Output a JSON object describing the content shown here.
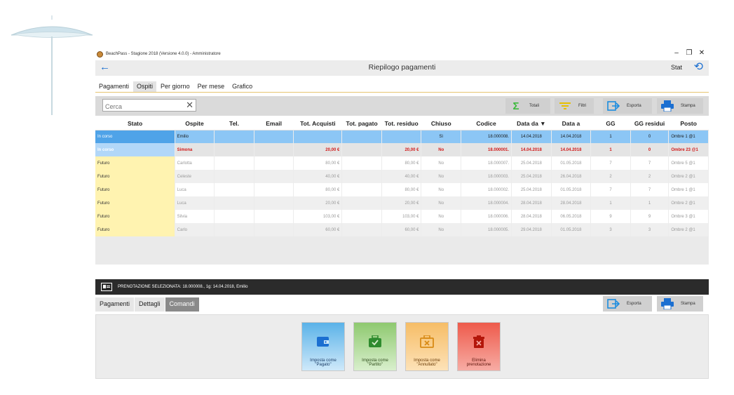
{
  "window": {
    "title": "BeachPass - Stagione 2018 (Versione 4.0.0) - Amministratore",
    "controls": [
      "–",
      "❐",
      "✕"
    ]
  },
  "header": {
    "back_icon": "←",
    "title": "Riepilogo pagamenti",
    "stat_label": "Stat",
    "refresh_icon": "⟲"
  },
  "top_tabs": [
    {
      "label": "Pagamenti",
      "active": false
    },
    {
      "label": "Ospiti",
      "active": true
    },
    {
      "label": "Per giorno",
      "active": false
    },
    {
      "label": "Per mese",
      "active": false
    },
    {
      "label": "Grafico",
      "active": false
    }
  ],
  "toolbar": {
    "search_placeholder": "Cerca",
    "clear_icon": "✕",
    "totali_label": "Totali",
    "filtri_label": "Filtri",
    "esporta_label": "Esporta",
    "stampa_label": "Stampa"
  },
  "table": {
    "headers": [
      "Stato",
      "Ospite",
      "Tel.",
      "Email",
      "Tot. Acquisti",
      "Tot. pagato",
      "Tot. residuo",
      "Chiuso",
      "Codice",
      "Data da ▼",
      "Data a",
      "GG",
      "GG residui",
      "Posto"
    ],
    "rows": [
      {
        "kind": "sel",
        "cells": [
          "In corso",
          "Emilio",
          "",
          "",
          "",
          "",
          "",
          "Sì",
          "18.000008.",
          "14.04.2018",
          "14.04.2018",
          "1",
          "0",
          "Ombre 1 @1"
        ]
      },
      {
        "kind": "inc",
        "cells": [
          "In corso",
          "Simona",
          "",
          "",
          "20,00 €",
          "",
          "20,00 €",
          "No",
          "18.000001.",
          "14.04.2018",
          "14.04.2018",
          "1",
          "0",
          "Ombre 23 @1"
        ]
      },
      {
        "kind": "fut",
        "cells": [
          "Futuro",
          "Carlotta",
          "",
          "",
          "80,00 €",
          "",
          "80,00 €",
          "No",
          "18.000007.",
          "25.04.2018",
          "01.05.2018",
          "7",
          "7",
          "Ombre 5 @1"
        ]
      },
      {
        "kind": "fut alt",
        "cells": [
          "Futuro",
          "Celeste",
          "",
          "",
          "40,00 €",
          "",
          "40,00 €",
          "No",
          "18.000003.",
          "25.04.2018",
          "26.04.2018",
          "2",
          "2",
          "Ombre 2 @1"
        ]
      },
      {
        "kind": "fut",
        "cells": [
          "Futuro",
          "Luca",
          "",
          "",
          "80,00 €",
          "",
          "80,00 €",
          "No",
          "18.000002.",
          "25.04.2018",
          "01.05.2018",
          "7",
          "7",
          "Ombre 1 @1"
        ]
      },
      {
        "kind": "fut alt",
        "cells": [
          "Futuro",
          "Luca",
          "",
          "",
          "20,00 €",
          "",
          "20,00 €",
          "No",
          "18.000004.",
          "28.04.2018",
          "28.04.2018",
          "1",
          "1",
          "Ombre 2 @1"
        ]
      },
      {
        "kind": "fut",
        "cells": [
          "Futuro",
          "Silvia",
          "",
          "",
          "103,00 €",
          "",
          "103,00 €",
          "No",
          "18.000006.",
          "28.04.2018",
          "06.05.2018",
          "9",
          "9",
          "Ombre 3 @1"
        ]
      },
      {
        "kind": "fut alt",
        "cells": [
          "Futuro",
          "Carlo",
          "",
          "",
          "60,00 €",
          "",
          "60,00 €",
          "No",
          "18.000005.",
          "29.04.2018",
          "01.05.2018",
          "3",
          "3",
          "Ombre 2 @1"
        ]
      }
    ]
  },
  "status": {
    "text": "PRENOTAZIONE SELEZIONATA: 18.000008., 1g: 14.04.2018, Emilio"
  },
  "bottom_tabs": [
    {
      "label": "Pagamenti",
      "active": false
    },
    {
      "label": "Dettagli",
      "active": false
    },
    {
      "label": "Comandi",
      "active": true
    }
  ],
  "bottom_toolbar": {
    "esporta_label": "Esporta",
    "stampa_label": "Stampa"
  },
  "commands": [
    {
      "line1": "Imposta come",
      "line2": "\"Pagato\"",
      "icon": "wallet-icon"
    },
    {
      "line1": "Imposta come",
      "line2": "\"Partito\"",
      "icon": "suitcase-icon"
    },
    {
      "line1": "Imposta come",
      "line2": "\"Annullato\"",
      "icon": "cancel-box-icon"
    },
    {
      "line1": "Elimina",
      "line2": "prenotazione",
      "icon": "trash-icon"
    }
  ],
  "colors": {
    "accent": "#1b6fd1",
    "selected_row": "#8cc6f5",
    "in_corso": "#4fa3e8",
    "futuro": "#fff3b0",
    "alert_red": "#d01919",
    "status_bar": "#2b2b2b"
  }
}
